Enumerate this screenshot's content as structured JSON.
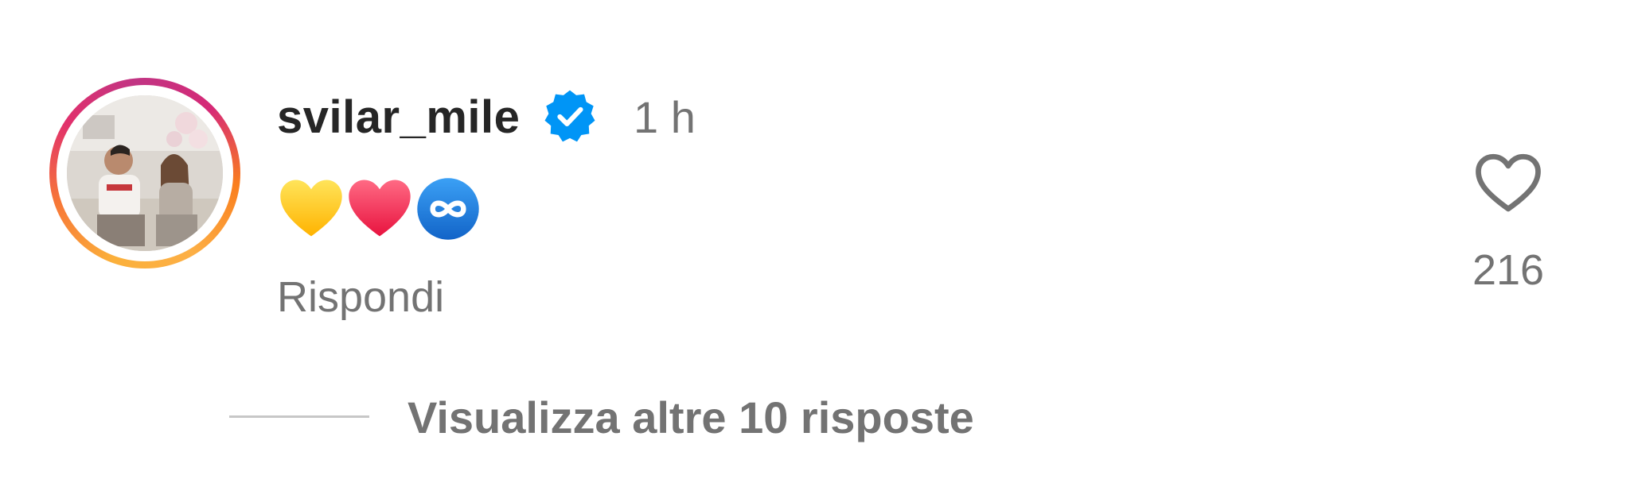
{
  "comment": {
    "username": "svilar_mile",
    "verified_icon": "verified-badge-icon",
    "timestamp": "1 h",
    "emojis": [
      "yellow-heart",
      "red-heart",
      "infinity"
    ],
    "reply_label": "Rispondi",
    "like_icon": "heart-outline-icon",
    "like_count": "216",
    "view_replies_label": "Visualizza altre 10 risposte"
  },
  "colors": {
    "text_primary": "#262626",
    "text_secondary": "#737373",
    "verified_blue": "#0095f6",
    "heart_red": "#f0305a",
    "heart_yellow": "#ffcc1f"
  }
}
